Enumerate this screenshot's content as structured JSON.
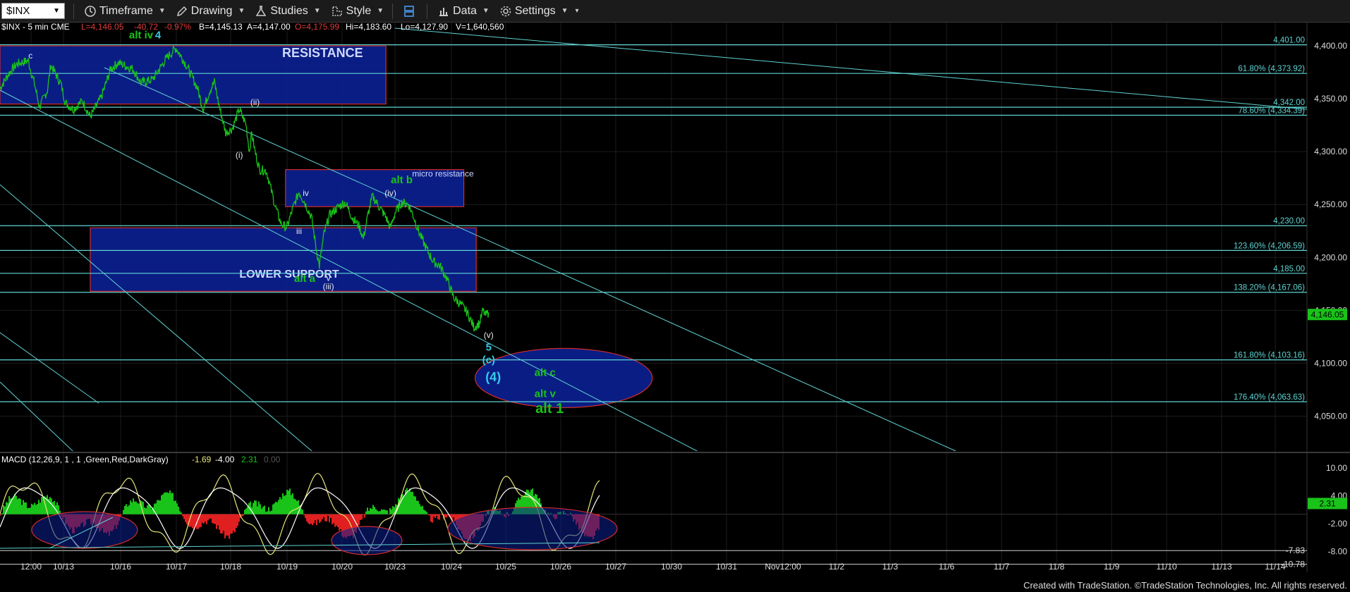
{
  "toolbar": {
    "symbol": "$INX",
    "items": [
      {
        "label": "Timeframe",
        "icon": "clock-icon"
      },
      {
        "label": "Drawing",
        "icon": "pencil-icon"
      },
      {
        "label": "Studies",
        "icon": "flask-icon"
      },
      {
        "label": "Style",
        "icon": "style-icon"
      },
      {
        "label": "",
        "icon": "layout-icon"
      },
      {
        "label": "Data",
        "icon": "bar-chart-icon"
      },
      {
        "label": "Settings",
        "icon": "gear-icon"
      }
    ]
  },
  "header": {
    "symbol_info": "$INX - 5 min  CME",
    "last": "L=4,146.05",
    "change": "-40.72",
    "pct": "-0.97%",
    "bid": "B=4,145.13",
    "ask": "A=4,147.00",
    "open": "O=4,175.99",
    "high": "Hi=4,183.60",
    "low": "Lo=4,127.90",
    "volume": "V=1,640,560"
  },
  "colors": {
    "price": "#19c319",
    "channel": "#5fd3d3",
    "box_fill": "#0b1f8f",
    "box_edge": "#d22b2b",
    "label_green": "#19c319",
    "label_cyan": "#38c8e8"
  },
  "chart_data": {
    "type": "line",
    "title": "$INX - 5 min",
    "price_axis": {
      "ticks": [
        4400,
        4350,
        4300,
        4250,
        4200,
        4150,
        4100,
        4050
      ],
      "tick_labels": [
        "4,400.00",
        "4,350.00",
        "4,300.00",
        "4,250.00",
        "4,200.00",
        "4,150.00",
        "4,100.00",
        "4,050.00"
      ],
      "range": [
        4017,
        4422
      ]
    },
    "date_axis": {
      "labels": [
        "12:00",
        "10/13",
        "10/16",
        "10/17",
        "10/18",
        "10/19",
        "10/20",
        "10/23",
        "10/24",
        "10/25",
        "10/26",
        "10/27",
        "10/30",
        "10/31",
        "Nov12:00",
        "11/2",
        "11/3",
        "11/6",
        "11/7",
        "11/8",
        "11/9",
        "11/10",
        "11/13",
        "11/14"
      ]
    },
    "series": [
      {
        "name": "$INX",
        "points": [
          [
            0,
            4360
          ],
          [
            8,
            4374
          ],
          [
            15,
            4383
          ],
          [
            25,
            4386
          ],
          [
            31,
            4362
          ],
          [
            35,
            4342
          ],
          [
            42,
            4358
          ],
          [
            45,
            4382
          ],
          [
            54,
            4364
          ],
          [
            58,
            4346
          ],
          [
            65,
            4340
          ],
          [
            73,
            4348
          ],
          [
            80,
            4333
          ],
          [
            90,
            4352
          ],
          [
            98,
            4378
          ],
          [
            105,
            4384
          ],
          [
            118,
            4378
          ],
          [
            125,
            4365
          ],
          [
            135,
            4368
          ],
          [
            148,
            4389
          ],
          [
            156,
            4398
          ],
          [
            165,
            4382
          ],
          [
            175,
            4360
          ],
          [
            180,
            4340
          ],
          [
            186,
            4358
          ],
          [
            190,
            4366
          ],
          [
            194,
            4344
          ],
          [
            200,
            4318
          ],
          [
            206,
            4322
          ],
          [
            212,
            4340
          ],
          [
            218,
            4326
          ],
          [
            221,
            4300
          ],
          [
            223,
            4318
          ],
          [
            226,
            4300
          ],
          [
            230,
            4283
          ],
          [
            236,
            4282
          ],
          [
            240,
            4265
          ],
          [
            244,
            4248
          ],
          [
            249,
            4232
          ],
          [
            254,
            4228
          ],
          [
            260,
            4248
          ],
          [
            265,
            4262
          ],
          [
            270,
            4252
          ],
          [
            276,
            4238
          ],
          [
            280,
            4210
          ],
          [
            283,
            4192
          ],
          [
            287,
            4222
          ],
          [
            292,
            4240
          ],
          [
            300,
            4248
          ],
          [
            306,
            4252
          ],
          [
            312,
            4238
          ],
          [
            318,
            4230
          ],
          [
            322,
            4218
          ],
          [
            326,
            4240
          ],
          [
            330,
            4258
          ],
          [
            336,
            4248
          ],
          [
            342,
            4238
          ],
          [
            346,
            4228
          ],
          [
            350,
            4242
          ],
          [
            356,
            4252
          ],
          [
            362,
            4250
          ],
          [
            366,
            4240
          ],
          [
            372,
            4222
          ],
          [
            378,
            4208
          ],
          [
            384,
            4196
          ],
          [
            390,
            4192
          ],
          [
            396,
            4180
          ],
          [
            402,
            4162
          ],
          [
            408,
            4156
          ],
          [
            414,
            4148
          ],
          [
            420,
            4134
          ],
          [
            425,
            4138
          ],
          [
            428,
            4150
          ],
          [
            430,
            4145
          ],
          [
            433,
            4148
          ]
        ]
      },
      {
        "name": "MACD",
        "values": [
          -1.69,
          -4.0,
          2.31,
          0.0
        ]
      }
    ],
    "horizontal_levels": [
      {
        "price": 4401.0,
        "label": "4,401.00"
      },
      {
        "price": 4373.92,
        "label": "61.80% (4,373.92)"
      },
      {
        "price": 4342.0,
        "label": "4,342.00"
      },
      {
        "price": 4334.39,
        "label": "78.60% (4,334.39)"
      },
      {
        "price": 4230.0,
        "label": "4,230.00"
      },
      {
        "price": 4206.59,
        "label": "123.60% (4,206.59)"
      },
      {
        "price": 4185.0,
        "label": "4,185.00"
      },
      {
        "price": 4167.06,
        "label": "138.20% (4,167.06)"
      },
      {
        "price": 4103.16,
        "label": "161.80% (4,103.16)"
      },
      {
        "price": 4063.63,
        "label": "176.40% (4,063.63)"
      }
    ],
    "last_price_tag": "4,146.05",
    "zones": [
      {
        "label": "RESISTANCE",
        "kind": "rect",
        "x_range": [
          0,
          342
        ],
        "price_range": [
          4345,
          4400
        ]
      },
      {
        "label": "micro resistance",
        "kind": "rect",
        "x_range": [
          253,
          411
        ],
        "price_range": [
          4248,
          4283
        ]
      },
      {
        "label": "LOWER SUPPORT",
        "kind": "rect",
        "x_range": [
          80,
          422
        ],
        "price_range": [
          4168,
          4228
        ]
      },
      {
        "label": "",
        "kind": "ellipse",
        "x_range": [
          421,
          578
        ],
        "price_range": [
          4058,
          4114
        ]
      }
    ],
    "wave_labels": [
      {
        "text": "alt iv",
        "color": "green",
        "x": 125,
        "price": 4407
      },
      {
        "text": "4",
        "color": "cyan",
        "x": 140,
        "price": 4407
      },
      {
        "text": "c",
        "color": "white",
        "x": 27,
        "price": 4388
      },
      {
        "text": "(ii)",
        "color": "white",
        "x": 226,
        "price": 4344
      },
      {
        "text": "(i)",
        "color": "white",
        "x": 212,
        "price": 4294
      },
      {
        "text": "iv",
        "color": "white",
        "x": 271,
        "price": 4258
      },
      {
        "text": "alt b",
        "color": "green",
        "x": 356,
        "price": 4270
      },
      {
        "text": "(iv)",
        "color": "white",
        "x": 346,
        "price": 4258
      },
      {
        "text": "iii",
        "color": "white",
        "x": 265,
        "price": 4222
      },
      {
        "text": "alt a",
        "color": "green",
        "x": 270,
        "price": 4177
      },
      {
        "text": "v",
        "color": "white",
        "x": 291,
        "price": 4178
      },
      {
        "text": "(iii)",
        "color": "white",
        "x": 291,
        "price": 4170
      },
      {
        "text": "(v)",
        "color": "white",
        "x": 433,
        "price": 4124
      },
      {
        "text": "5",
        "color": "cyan",
        "x": 433,
        "price": 4112
      },
      {
        "text": "(c)",
        "color": "cyan",
        "x": 433,
        "price": 4100
      },
      {
        "text": "(4)",
        "color": "cyan",
        "x": 437,
        "price": 4083
      },
      {
        "text": "alt c",
        "color": "green",
        "x": 483,
        "price": 4088
      },
      {
        "text": "alt v",
        "color": "green",
        "x": 483,
        "price": 4068
      },
      {
        "text": "alt 1",
        "color": "green",
        "x": 487,
        "price": 4053
      }
    ],
    "macd": {
      "label": "MACD (12,26,9, 1 , 1 ,Green,Red,DarkGray)",
      "readouts": [
        "-1.69",
        "-4.00",
        "2.31",
        "0.00"
      ],
      "ticks": [
        10,
        4,
        -2,
        -8
      ],
      "tick_labels": [
        "10.00",
        "4.00",
        "-2.00",
        "-8.00"
      ],
      "levels": [
        {
          "value": -7.83,
          "label": "-7.83"
        },
        {
          "value": -10.78,
          "label": "-10.78"
        }
      ],
      "last_tag": "2.31",
      "range": [
        -12.5,
        13
      ]
    }
  },
  "footer": {
    "credit": "Created with TradeStation. ©TradeStation Technologies, Inc. All rights reserved."
  }
}
